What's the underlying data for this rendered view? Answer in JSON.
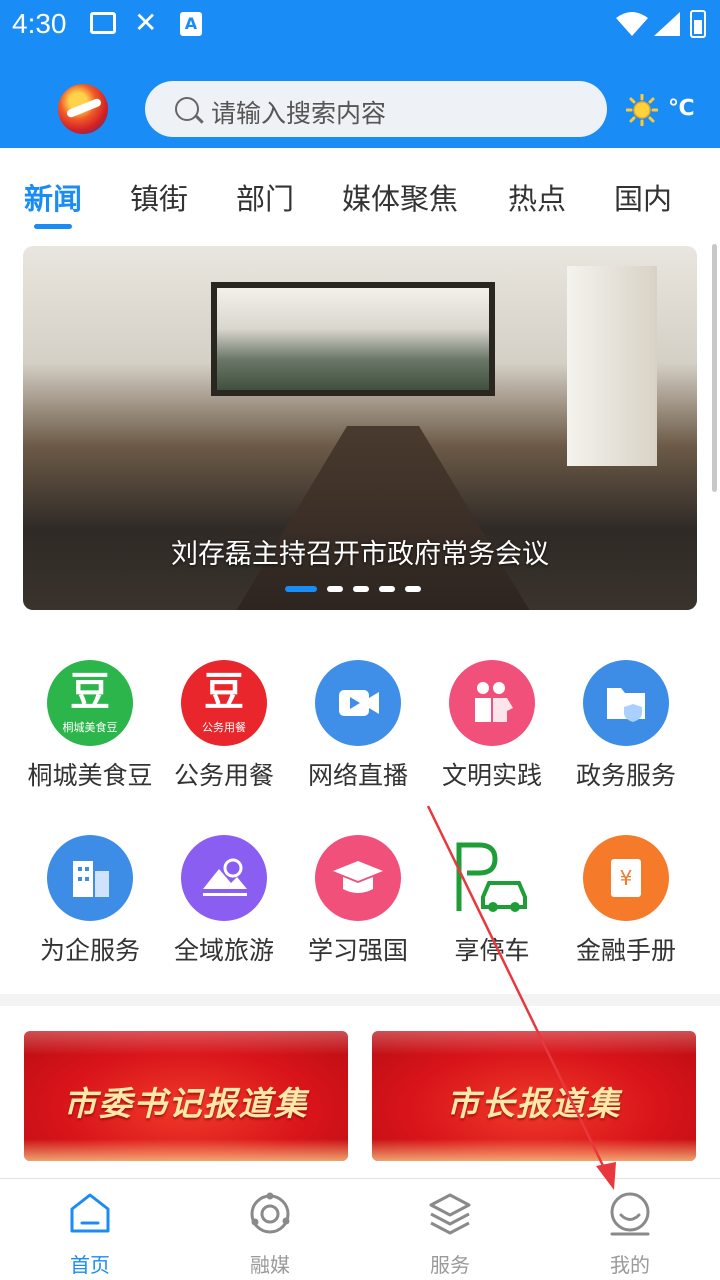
{
  "status_bar": {
    "time": "4:30"
  },
  "header": {
    "search_placeholder": "请输入搜索内容",
    "weather": "℃"
  },
  "tabs": [
    {
      "label": "新闻",
      "active": true
    },
    {
      "label": "镇街"
    },
    {
      "label": "部门"
    },
    {
      "label": "媒体聚焦"
    },
    {
      "label": "热点"
    },
    {
      "label": "国内"
    }
  ],
  "banner": {
    "caption": "刘存磊主持召开市政府常务会议",
    "slide_count": 5,
    "active_index": 0
  },
  "services": [
    {
      "label": "桐城美食豆",
      "icon": "food-bean-icon",
      "badge_text": "豆",
      "badge_sub": "桐城美食豆",
      "color": "#2bb54a"
    },
    {
      "label": "公务用餐",
      "icon": "official-dining-icon",
      "badge_text": "豆",
      "badge_sub": "公务用餐",
      "color": "#e8262c"
    },
    {
      "label": "网络直播",
      "icon": "live-video-icon",
      "color": "#3f8fe8"
    },
    {
      "label": "文明实践",
      "icon": "volunteer-icon",
      "color": "#f0507a"
    },
    {
      "label": "政务服务",
      "icon": "gov-folder-icon",
      "color": "#3d8de6"
    },
    {
      "label": "为企服务",
      "icon": "enterprise-building-icon",
      "color": "#3d8de6"
    },
    {
      "label": "全域旅游",
      "icon": "tourism-landscape-icon",
      "color": "#8a5ef0"
    },
    {
      "label": "学习强国",
      "icon": "graduation-cap-icon",
      "color": "#f0507a"
    },
    {
      "label": "享停车",
      "icon": "parking-car-icon",
      "color": "#1f9e38"
    },
    {
      "label": "金融手册",
      "icon": "finance-book-icon",
      "color": "#f57a2a"
    }
  ],
  "promos": [
    {
      "title": "市委书记报道集"
    },
    {
      "title": "市长报道集"
    }
  ],
  "bottom_nav": [
    {
      "label": "首页",
      "icon": "home-icon",
      "active": true
    },
    {
      "label": "融媒",
      "icon": "media-orbit-icon"
    },
    {
      "label": "服务",
      "icon": "layers-icon"
    },
    {
      "label": "我的",
      "icon": "profile-smile-icon"
    }
  ],
  "colors": {
    "primary": "#1a8cf5",
    "annotation": "#e8383d"
  }
}
